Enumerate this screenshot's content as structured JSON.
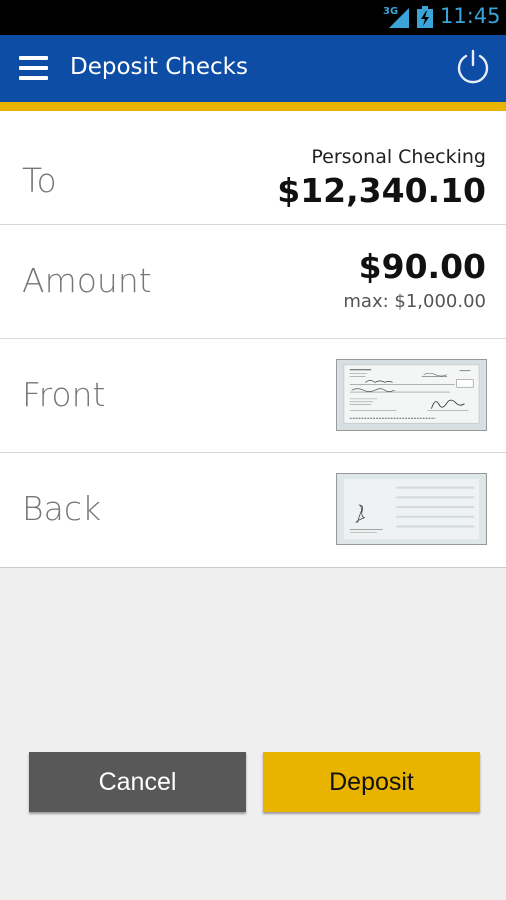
{
  "status_bar": {
    "network": "3G",
    "time": "11:45"
  },
  "app_bar": {
    "title": "Deposit Checks"
  },
  "rows": {
    "to": {
      "label": "To",
      "account_name": "Personal Checking",
      "account_balance": "$12,340.10"
    },
    "amount": {
      "label": "Amount",
      "value": "$90.00",
      "max": "max: $1,000.00"
    },
    "front": {
      "label": "Front"
    },
    "back": {
      "label": "Back"
    }
  },
  "buttons": {
    "cancel": "Cancel",
    "deposit": "Deposit"
  },
  "colors": {
    "app_bar": "#0e4da5",
    "accent": "#e8b400",
    "cancel_button": "#585858",
    "status_text": "#3aa3d8"
  },
  "icons": {
    "menu": "menu-icon",
    "power": "power-icon",
    "signal": "signal-icon",
    "battery": "battery-charging-icon"
  }
}
